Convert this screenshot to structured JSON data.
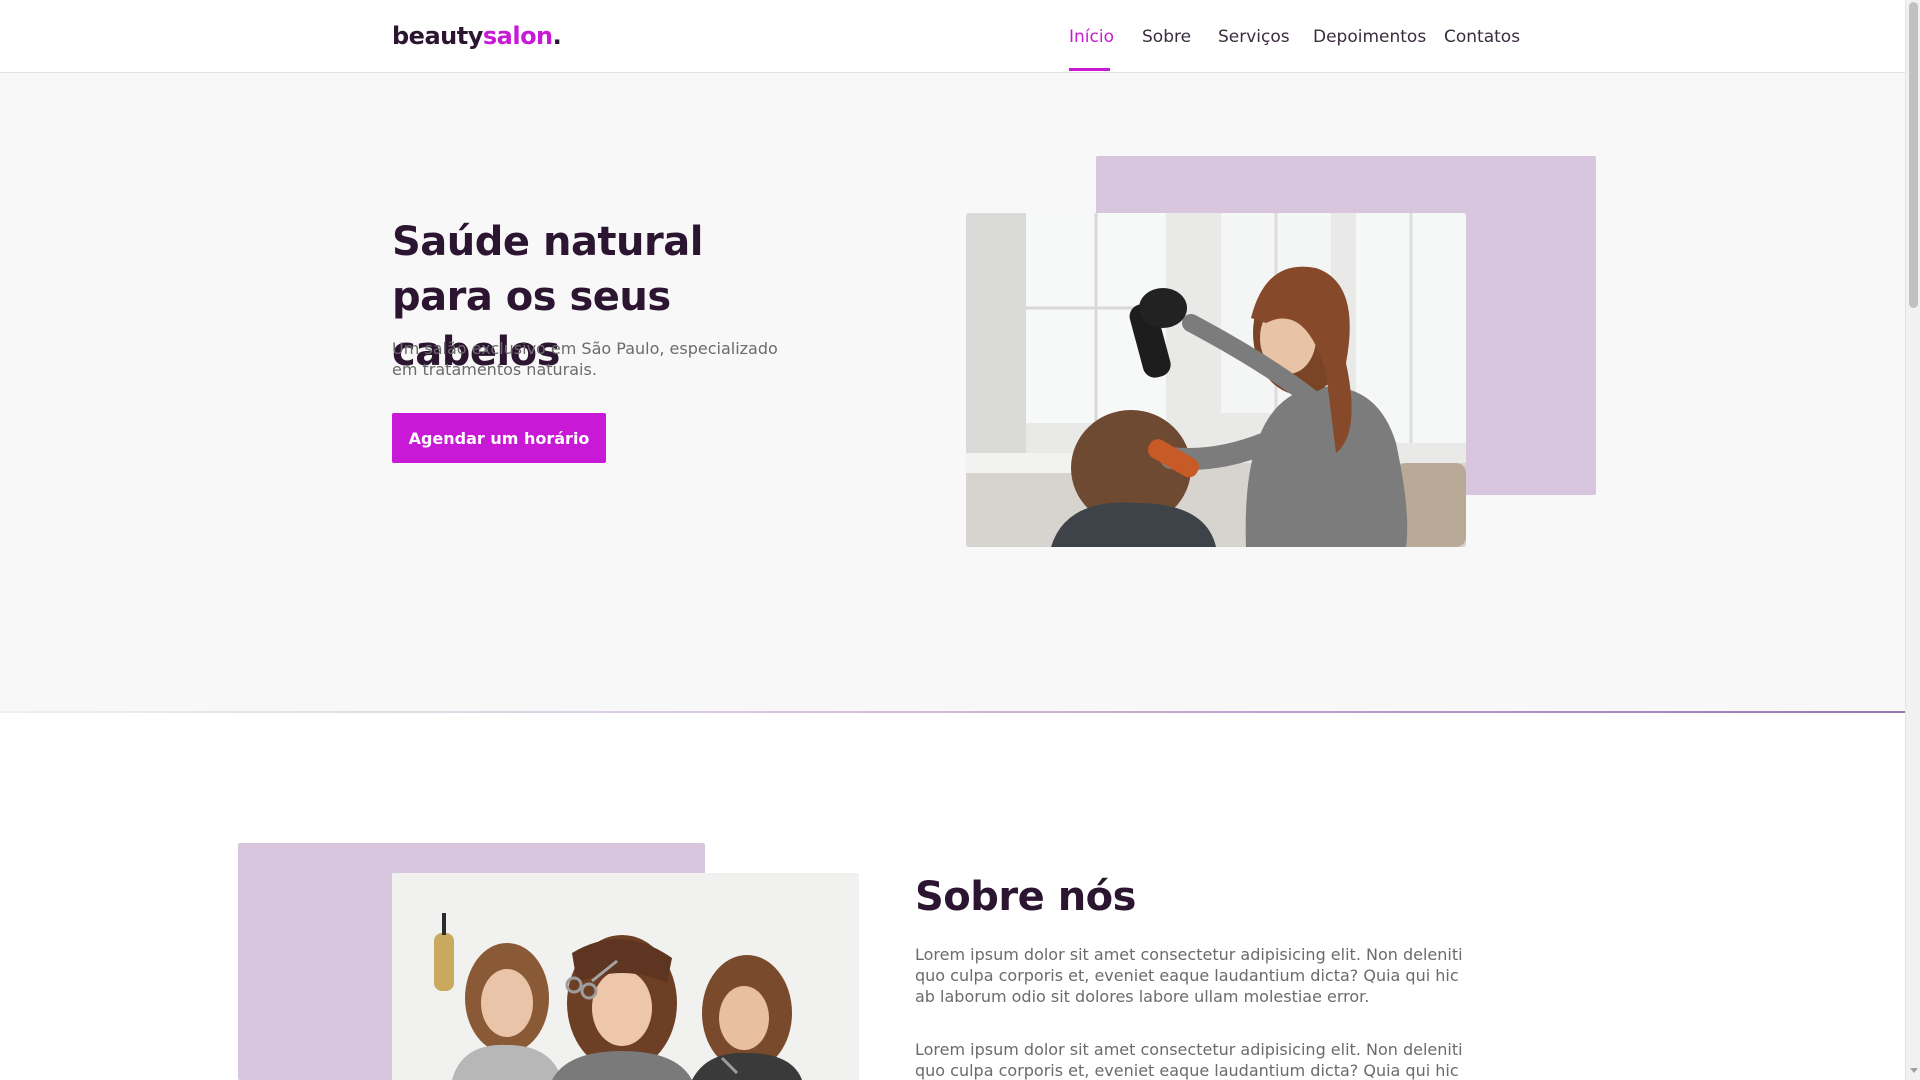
{
  "brand": {
    "part1": "beauty",
    "part2": "salon",
    "dot": "."
  },
  "nav": {
    "items": [
      {
        "label": "Início",
        "active": true
      },
      {
        "label": "Sobre",
        "active": false
      },
      {
        "label": "Serviços",
        "active": false
      },
      {
        "label": "Depoimentos",
        "active": false
      },
      {
        "label": "Contatos",
        "active": false
      }
    ]
  },
  "hero": {
    "title": "Saúde natural para os seus cabelos",
    "subtitle": "Um salão exclusivo em São Paulo, especializado em tratamentos naturais.",
    "cta_label": "Agendar um horário"
  },
  "about": {
    "title": "Sobre nós",
    "paragraphs": [
      "Lorem ipsum dolor sit amet consectetur adipisicing elit. Non deleniti quo culpa corporis et, eveniet eaque laudantium dicta? Quia qui hic ab laborum odio sit dolores labore ullam molestiae error.",
      "Lorem ipsum dolor sit amet consectetur adipisicing elit. Non deleniti quo culpa corporis et, eveniet eaque laudantium dicta? Quia qui hic ab laborum"
    ]
  },
  "colors": {
    "accent": "#c81ad6",
    "dark": "#2b1530",
    "lilac": "#d8c6df",
    "background": "#f8f8f8"
  }
}
